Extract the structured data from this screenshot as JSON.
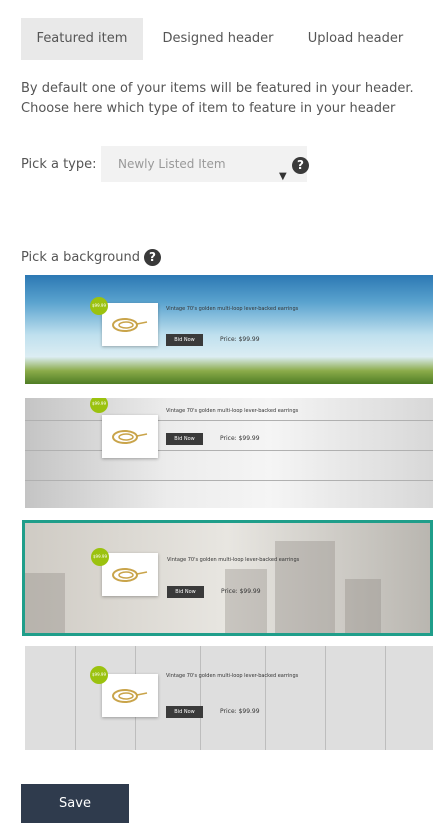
{
  "tabs": [
    {
      "label": "Featured item",
      "active": true
    },
    {
      "label": "Designed header",
      "active": false
    },
    {
      "label": "Upload header",
      "active": false
    }
  ],
  "description": {
    "line1": "By default one of your items will be featured in your header.",
    "line2": "Choose here which type of item to feature in your header"
  },
  "type_picker": {
    "label": "Pick a type:",
    "selected": "Newly Listed Item"
  },
  "background_picker": {
    "label": "Pick a background",
    "selected_index": 2,
    "selected_color": "#1f9e8a"
  },
  "preview_item": {
    "title": "Vintage 70's golden multi-loop lever-backed earrings",
    "bid_label": "Bid Now",
    "price": "Price: $99.99",
    "badge": "$99.99",
    "badge_color": "#9bc20f"
  },
  "save_button": {
    "label": "Save",
    "color": "#2f3b4d"
  },
  "icons": {
    "help": "?",
    "caret": "▼"
  }
}
